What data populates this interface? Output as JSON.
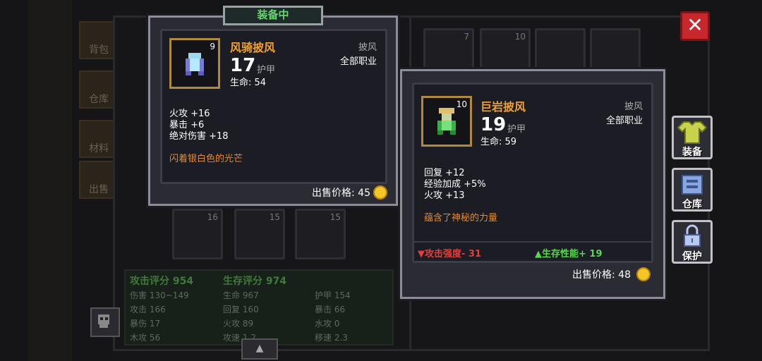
{
  "left_tabs": [
    "背包",
    "仓库",
    "材料",
    "出售"
  ],
  "bg_slots": [
    {
      "level": "7"
    },
    {
      "level": "10"
    },
    {
      "level": "16"
    },
    {
      "level": "15"
    },
    {
      "level": "15"
    }
  ],
  "stats": {
    "attack_score": "攻击评分 954",
    "survive_score": "生存评分 974",
    "cells": [
      "伤害 130~149",
      "生命 967",
      "护甲 154",
      "攻击 166",
      "回复 160",
      "暴击 66",
      "暴伤 17",
      "火攻 89",
      "水攻 0",
      "木攻 56",
      "攻速 1.2",
      "移速 2.3"
    ]
  },
  "equipped_tag": "装备中",
  "equipped": {
    "level": "9",
    "name": "风骑披风",
    "type": "披风",
    "class": "全部职业",
    "armor_value": "17",
    "armor_label": "护甲",
    "hp_line": "生命:  54",
    "bonuses": [
      "火攻 +16",
      "暴击 +6",
      "绝对伤害 +18"
    ],
    "flavor": "闪着银白色的光芒",
    "sell": "出售价格: 45"
  },
  "compare": {
    "level": "10",
    "name": "巨岩披风",
    "type": "披风",
    "class": "全部职业",
    "armor_value": "19",
    "armor_label": "护甲",
    "hp_line": "生命:  59",
    "bonuses": [
      "回复 +12",
      "经验加成 +5%",
      "火攻 +13"
    ],
    "flavor": "蕴含了神秘的力量",
    "attack_diff": "▼攻击强度- 31",
    "survive_diff": "▲生存性能+ 19",
    "sell": "出售价格: 48",
    "down_color": "#e0403c",
    "up_color": "#58d84c"
  },
  "close_icon": "close-icon",
  "right_buttons": [
    "装备",
    "仓库",
    "保护"
  ]
}
